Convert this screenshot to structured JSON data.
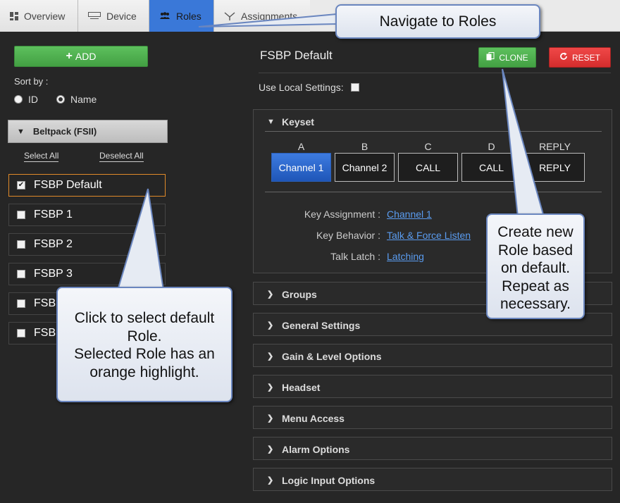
{
  "tabs": [
    {
      "label": "Overview",
      "icon": "grid-icon"
    },
    {
      "label": "Device",
      "icon": "device-icon"
    },
    {
      "label": "Roles",
      "icon": "users-icon",
      "active": true
    },
    {
      "label": "Assignments",
      "icon": "assign-icon"
    }
  ],
  "left": {
    "add_label": "ADD",
    "sort_by_label": "Sort by :",
    "sort_options": [
      {
        "label": "ID",
        "selected": false
      },
      {
        "label": "Name",
        "selected": true
      }
    ],
    "group_label": "Beltpack (FSII)",
    "select_all": "Select All",
    "deselect_all": "Deselect All",
    "roles": [
      {
        "label": "FSBP Default",
        "checked": true,
        "selected": true
      },
      {
        "label": "FSBP 1",
        "checked": false
      },
      {
        "label": "FSBP 2",
        "checked": false
      },
      {
        "label": "FSBP 3",
        "checked": false
      },
      {
        "label": "FSBP",
        "checked": false
      },
      {
        "label": "FSBP",
        "checked": false
      }
    ]
  },
  "right": {
    "title": "FSBP Default",
    "clone_label": "CLONE",
    "reset_label": "RESET",
    "local_settings_label": "Use Local Settings:",
    "keyset": {
      "heading": "Keyset",
      "keys": [
        {
          "letter": "A",
          "label": "Channel 1",
          "active": true
        },
        {
          "letter": "B",
          "label": "Channel 2",
          "active": false
        },
        {
          "letter": "C",
          "label": "CALL",
          "active": false
        },
        {
          "letter": "D",
          "label": "CALL",
          "active": false
        },
        {
          "letter": "REPLY",
          "label": "REPLY",
          "active": false
        }
      ],
      "key_assignment_label": "Key Assignment :",
      "key_assignment_value": "Channel 1",
      "key_behavior_label": "Key Behavior :",
      "key_behavior_value": "Talk & Force Listen",
      "talk_latch_label": "Talk Latch :",
      "talk_latch_value": "Latching"
    },
    "sections": [
      "Groups",
      "General Settings",
      "Gain & Level Options",
      "Headset",
      "Menu Access",
      "Alarm Options",
      "Logic Input Options"
    ]
  },
  "callouts": {
    "navigate": "Navigate to Roles",
    "create": [
      "Create new",
      "Role based",
      "on default.",
      "Repeat as",
      "necessary."
    ],
    "select": [
      "Click to select default",
      "Role.",
      "Selected Role has an",
      "orange highlight."
    ]
  },
  "colors": {
    "active_tab": "#3a78d8",
    "add_green": "#4caf50",
    "reset_red": "#e53935",
    "selected_outline": "#e08a2a",
    "link_blue": "#5a9cf0"
  }
}
